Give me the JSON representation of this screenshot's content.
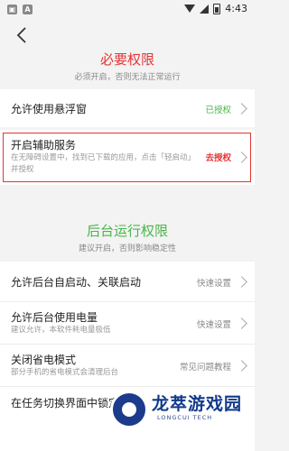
{
  "status_bar": {
    "icons": [
      "android-icon",
      "a-icon"
    ],
    "time": "4:43"
  },
  "required_section": {
    "title": "必要权限",
    "subtitle": "必须开启，否则无法正常运行",
    "items": [
      {
        "title": "允许使用悬浮窗",
        "status": "已授权"
      },
      {
        "title": "开启辅助服务",
        "desc": "在无障碍设置中，找到已下载的应用，点击「轻启动」并授权",
        "status": "去授权"
      }
    ]
  },
  "background_section": {
    "title": "后台运行权限",
    "subtitle": "建议开启，否则影响稳定性",
    "items": [
      {
        "title": "允许后台自启动、关联启动",
        "status": "快速设置"
      },
      {
        "title": "允许后台使用电量",
        "desc": "建议允许，本软件耗电量极低",
        "status": "快速设置"
      },
      {
        "title": "关闭省电模式",
        "desc": "部分手机的省电模式会清理后台",
        "status": "常见问题教程"
      },
      {
        "title": "在任务切换界面中锁定",
        "status": ""
      }
    ]
  },
  "watermark": {
    "brand": "龙萃游戏园",
    "sub": "LONGCUI TECH"
  },
  "colors": {
    "red": "#e53434",
    "green": "#49b64a"
  }
}
